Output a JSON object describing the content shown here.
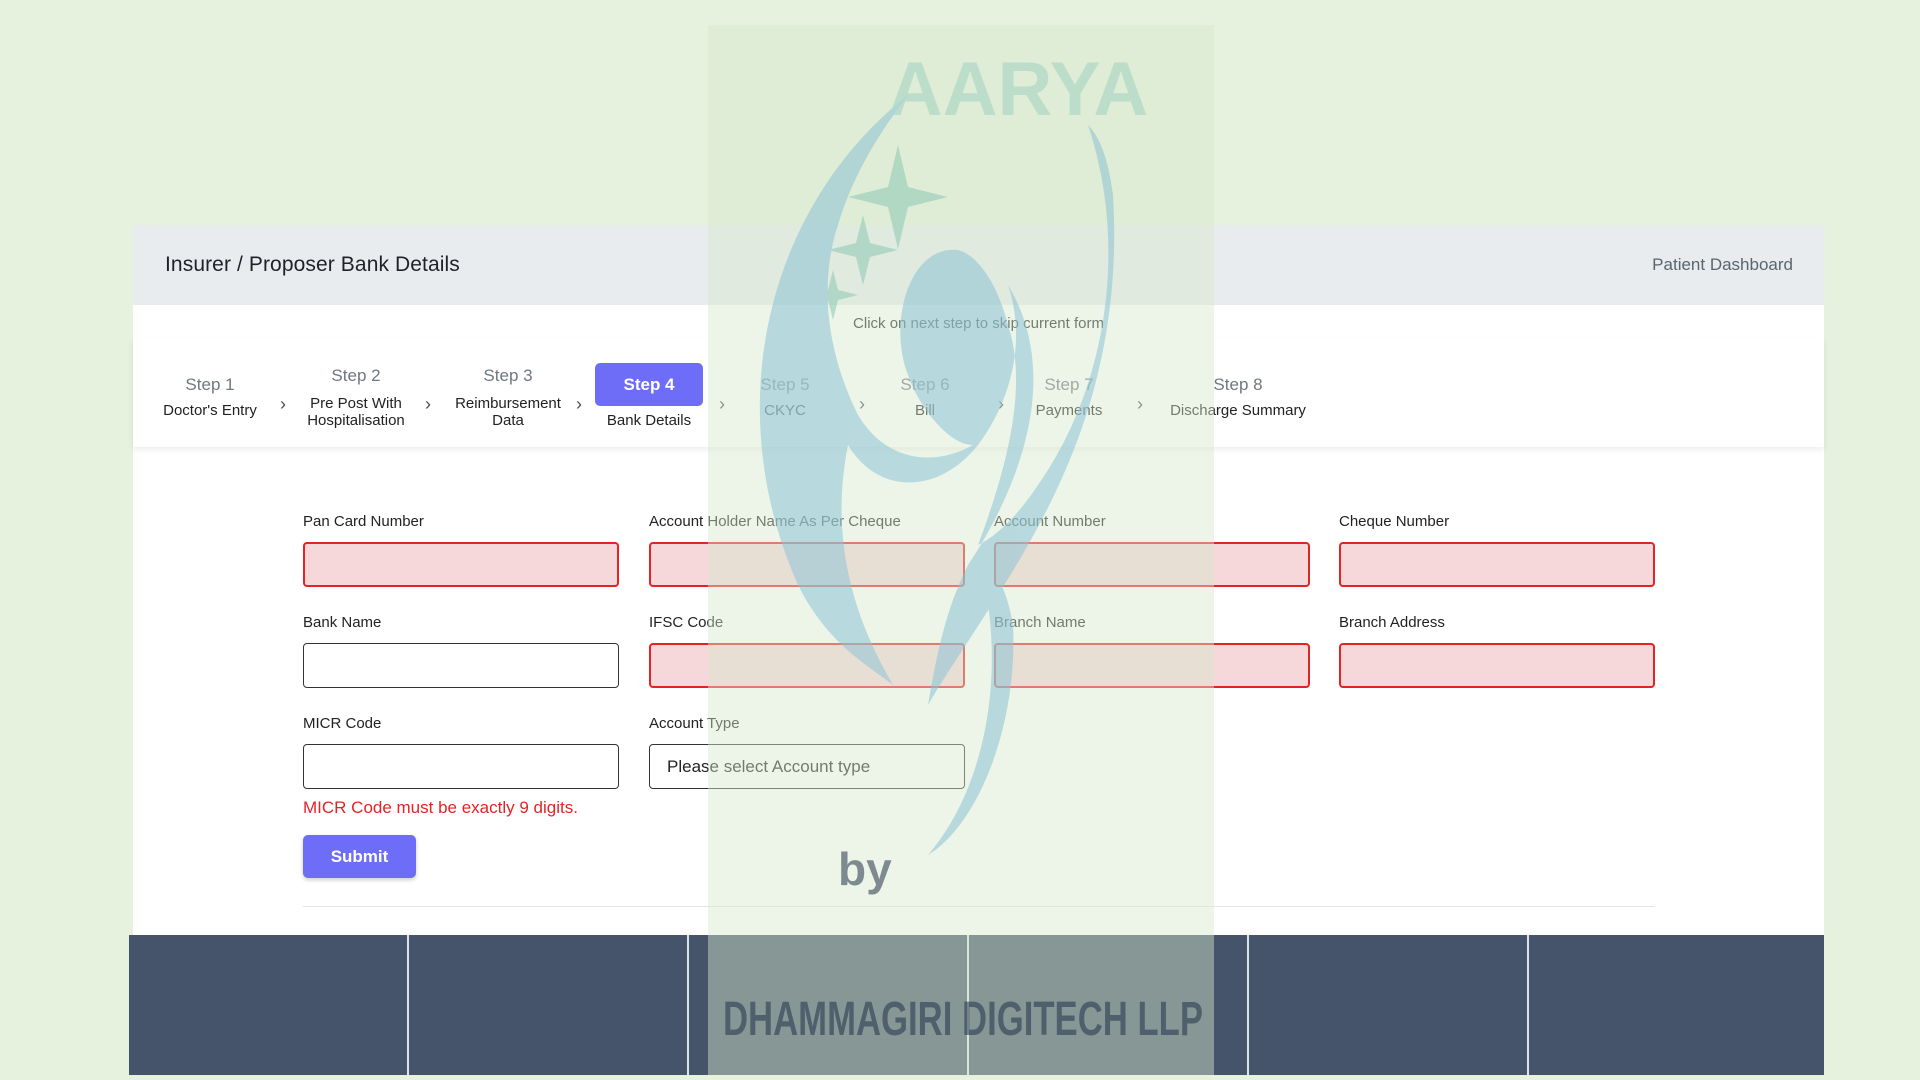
{
  "header": {
    "title": "Insurer / Proposer Bank Details",
    "dashboard_link": "Patient Dashboard"
  },
  "skip_note": "Click on next step to skip current form",
  "steps": [
    {
      "label": "Step 1",
      "sub": "Doctor's Entry"
    },
    {
      "label": "Step 2",
      "sub": "Pre Post With\nHospitalisation"
    },
    {
      "label": "Step 3",
      "sub": "Reimbursement\nData"
    },
    {
      "label": "Step 4",
      "sub": "Bank Details",
      "active": true
    },
    {
      "label": "Step 5",
      "sub": "CKYC"
    },
    {
      "label": "Step 6",
      "sub": "Bill"
    },
    {
      "label": "Step 7",
      "sub": "Payments"
    },
    {
      "label": "Step 8",
      "sub": "Discharge Summary"
    }
  ],
  "form": {
    "pan": {
      "label": "Pan Card Number",
      "value": "",
      "invalid": true
    },
    "holder": {
      "label": "Account Holder Name As Per Cheque",
      "value": "",
      "invalid": true
    },
    "account_number": {
      "label": "Account Number",
      "value": "",
      "invalid": true
    },
    "cheque": {
      "label": "Cheque Number",
      "value": "",
      "invalid": true
    },
    "bank_name": {
      "label": "Bank Name",
      "value": "",
      "invalid": false
    },
    "ifsc": {
      "label": "IFSC Code",
      "value": "",
      "invalid": true
    },
    "branch_name": {
      "label": "Branch Name",
      "value": "",
      "invalid": true
    },
    "branch_address": {
      "label": "Branch Address",
      "value": "",
      "invalid": true
    },
    "micr": {
      "label": "MICR Code",
      "value": "",
      "invalid": false,
      "error": "MICR Code must be exactly 9 digits."
    },
    "account_type": {
      "label": "Account Type",
      "selected": "Please select Account type"
    },
    "submit_label": "Submit"
  },
  "watermark": {
    "brand": "AARYA",
    "by": "by",
    "company": "DHAMMAGIRI DIGITECH LLP"
  },
  "colors": {
    "accent": "#6d6df7",
    "error": "#e32424",
    "invalid_fill": "#f6d7da",
    "footer": "#45546a",
    "page_bg": "#e6f1de"
  },
  "footer_columns": 6
}
